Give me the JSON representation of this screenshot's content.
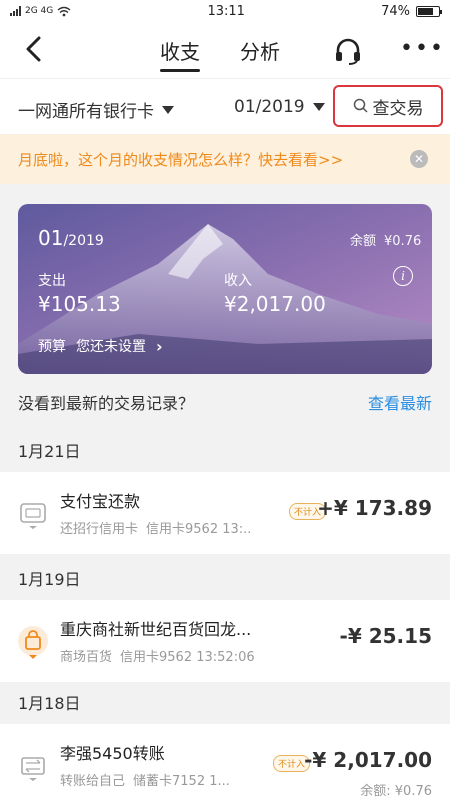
{
  "status_bar": {
    "left": "2G 4G",
    "time": "13:11",
    "battery": "74%",
    "battery_level": 0.74
  },
  "nav": {
    "tabs": [
      {
        "label": "收支",
        "active": true
      },
      {
        "label": "分析",
        "active": false
      }
    ]
  },
  "filter": {
    "card_selector": "一网通所有银行卡",
    "month_selector": "01/2019",
    "search_label": "查交易"
  },
  "notice": {
    "text": "月底啦，这个月的收支情况怎么样？快去看看>>"
  },
  "summary_card": {
    "month": "01",
    "year": "/2019",
    "balance_label": "余额",
    "balance_value": "¥0.76",
    "expense_label": "支出",
    "expense_value": "¥105.13",
    "income_label": "收入",
    "income_value": "¥2,017.00",
    "info_icon": "i",
    "budget_label": "预算",
    "budget_value": "您还未设置"
  },
  "latest": {
    "prompt": "没看到最新的交易记录？",
    "link": "查看最新"
  },
  "groups": [
    {
      "date": "1月21日",
      "transactions": [
        {
          "icon": "alipay-icon",
          "title": "支付宝还款",
          "desc": "还招行信用卡",
          "account": "信用卡9562 13:..",
          "tag": "不计入",
          "amount": "+¥ 173.89",
          "balance": ""
        }
      ]
    },
    {
      "date": "1月19日",
      "transactions": [
        {
          "icon": "shopping-bag-icon",
          "title": "重庆商社新世纪百货回龙...",
          "desc": "商场百货",
          "account": "信用卡9562 13:52:06",
          "tag": "",
          "amount": "-¥ 25.15",
          "balance": ""
        }
      ]
    },
    {
      "date": "1月18日",
      "transactions": [
        {
          "icon": "transfer-icon",
          "title": "李强5450转账",
          "desc": "转账给自己",
          "account": "储蓄卡7152 1...",
          "tag": "不计入",
          "amount": "-¥ 2,017.00",
          "balance": "余额: ¥0.76"
        }
      ]
    }
  ],
  "colors": {
    "accent_orange": "#f08a1c",
    "link_blue": "#2b8ee0",
    "highlight_red": "#d9363e"
  }
}
